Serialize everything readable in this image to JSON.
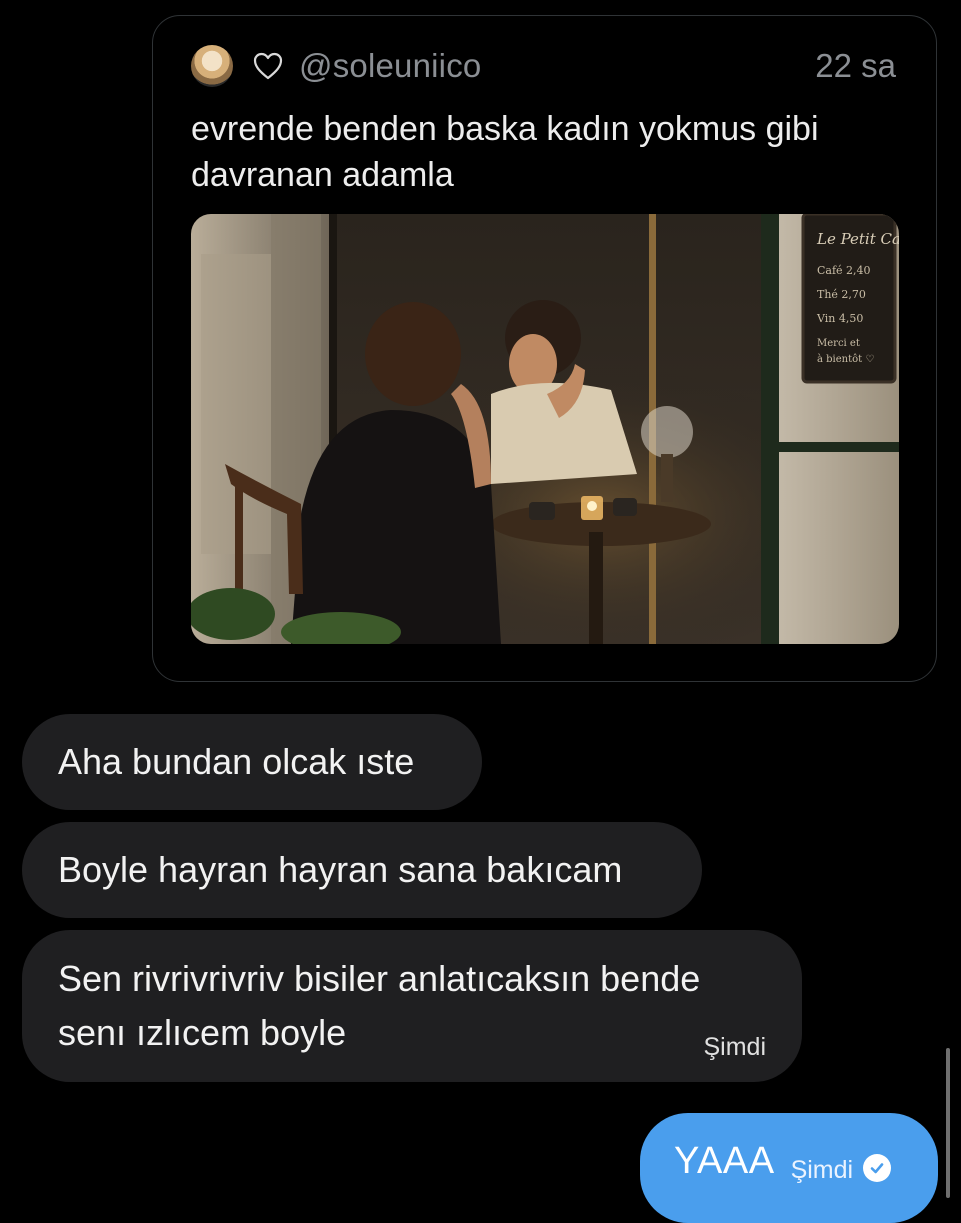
{
  "quoted_post": {
    "handle": "@soleuniico",
    "time": "22 sa",
    "text": "evrende benden baska kadın yokmus gibi davranan adamla",
    "avatar_icon": "avatar-photo",
    "like_icon": "heart-outline-icon",
    "media": {
      "sign_title": "Le Petit Café",
      "sign_lines": [
        "Café   2,40",
        "Thé   2,70",
        "Vin   4,50",
        "Merci et",
        "à bientôt ♡"
      ]
    }
  },
  "messages": [
    {
      "text": "Aha bundan olcak ıste"
    },
    {
      "text": "Boyle hayran hayran sana bakıcam"
    },
    {
      "text_line1": "Sen rivrivrivriv bisiler anlatıcaksın bende",
      "text_line2": "senı ızlıcem boyle",
      "time": "Şimdi"
    }
  ],
  "outgoing": {
    "text": "YAAA",
    "time": "Şimdi",
    "status_icon": "read-check-icon"
  },
  "colors": {
    "background": "#000000",
    "incoming_bubble": "#1f1f21",
    "outgoing_bubble": "#4a9eed",
    "muted_text": "#8b8f94"
  }
}
